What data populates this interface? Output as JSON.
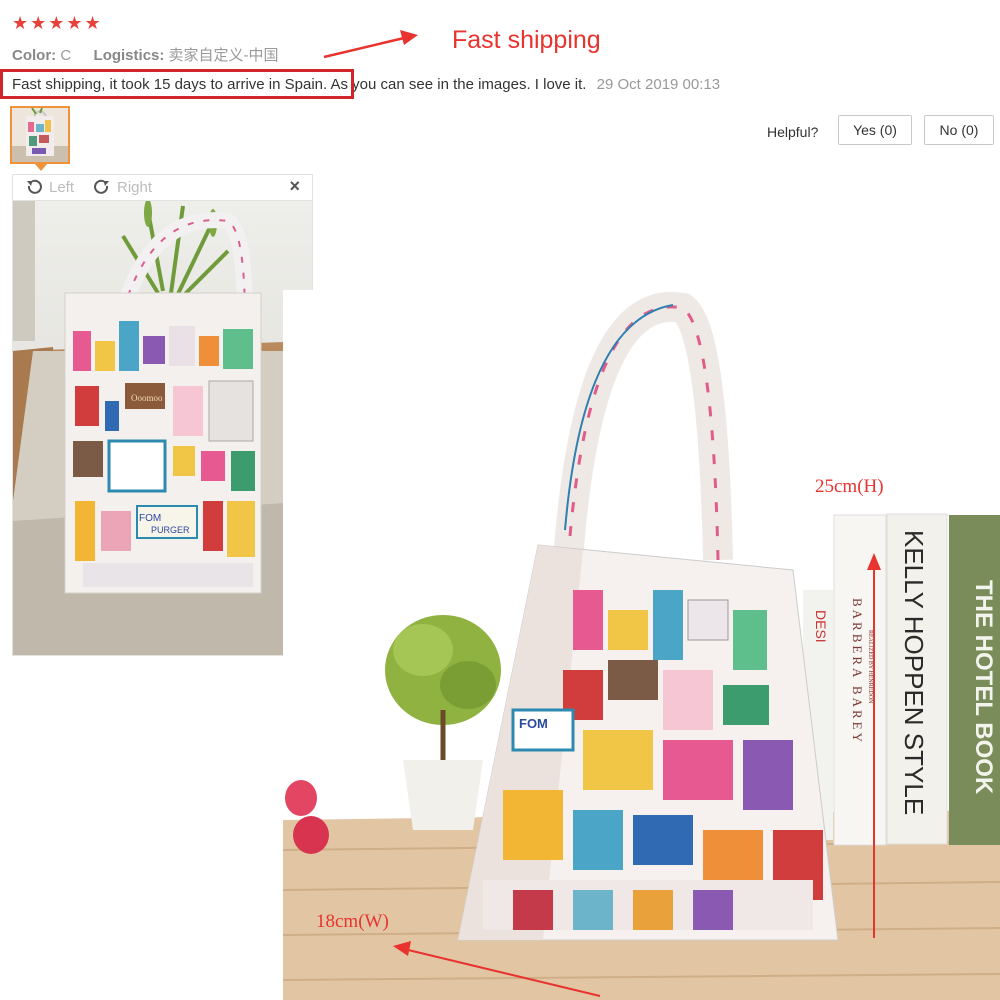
{
  "review": {
    "rating_stars": "★★★★★",
    "rating": 5,
    "color_label": "Color:",
    "color_value": "C",
    "logistics_label": "Logistics:",
    "logistics_value": "卖家自定义-中国",
    "text_highlighted": "Fast shipping, it took 15 days to arrive in Spain.",
    "text_rest": " As you can see in the images. I love it.",
    "date": "29 Oct 2019 00:13"
  },
  "annotations": {
    "fast_shipping": "Fast shipping",
    "height": "25cm(H)",
    "width": "18cm(W)",
    "accent_color": "#e8332f"
  },
  "helpful": {
    "label": "Helpful?",
    "yes": "Yes (0)",
    "no": "No (0)"
  },
  "viewer": {
    "left_label": "Left",
    "right_label": "Right",
    "close_label": "×",
    "left_icon": "rotate-left-icon",
    "right_icon": "rotate-right-icon"
  },
  "photo": {
    "bag_text_1": "FOM",
    "bag_text_2": "PURGER",
    "leather_tag": "Ooomoo",
    "book_1": "BARBERA BAREY",
    "book_1_small": "REALIZED BY HENREDON",
    "book_2": "KELLY HOPPEN STYLE",
    "book_3": "THE HOTEL BOOK",
    "book_0": "DESI"
  }
}
